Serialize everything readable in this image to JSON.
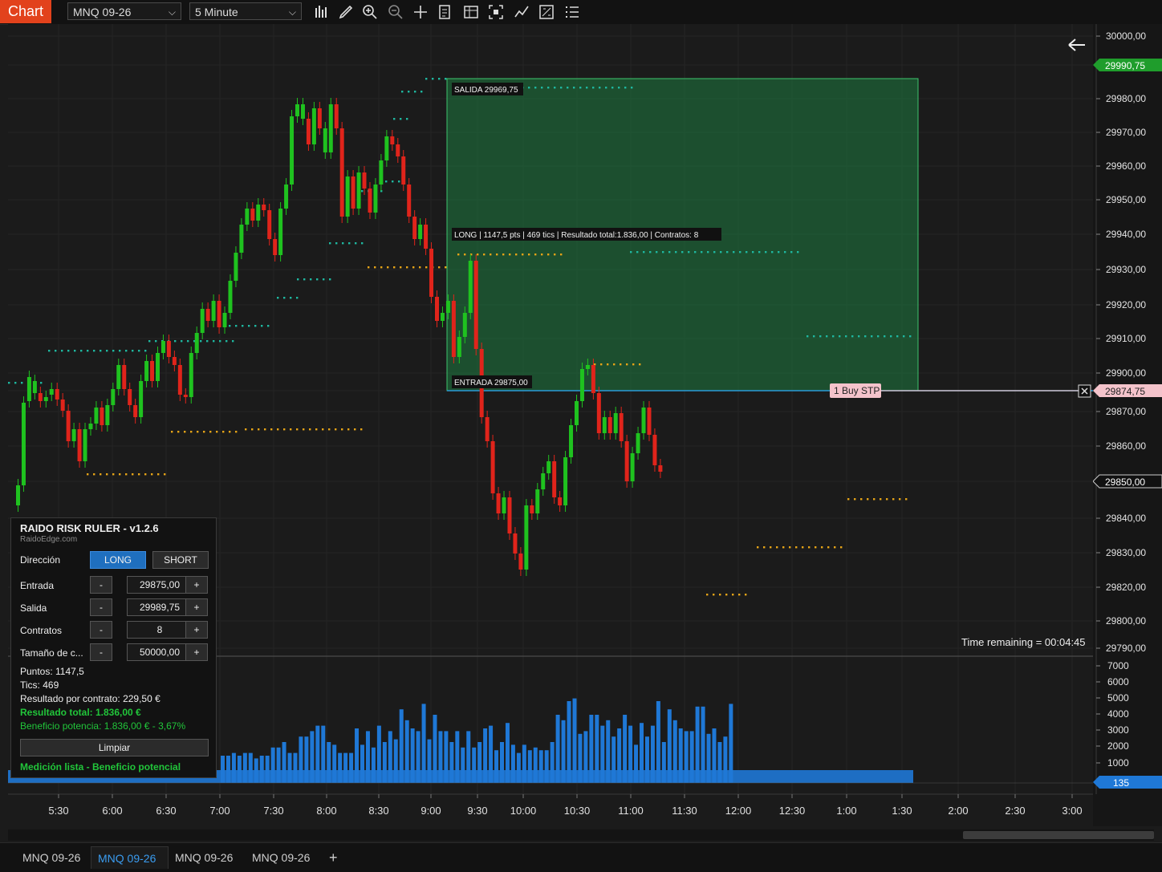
{
  "toolbar": {
    "chart_label": "Chart",
    "instrument": "MNQ 09-26",
    "interval": "5 Minute",
    "tools": [
      "bar-type-icon",
      "pencil-icon",
      "zoom-in-icon",
      "zoom-out-icon",
      "crosshair-icon",
      "template-icon",
      "data-box-icon",
      "properties-icon",
      "indicators-icon",
      "strategies-icon",
      "list-icon"
    ]
  },
  "chart": {
    "price_axis": [
      "30000,00",
      "29990,75",
      "29980,00",
      "29970,00",
      "29960,00",
      "29950,00",
      "29940,00",
      "29930,00",
      "29920,00",
      "29910,00",
      "29900,00",
      "29874,75",
      "29870,00",
      "29860,00",
      "29850,00",
      "29840,00",
      "29830,00",
      "29820,00",
      "29800,00",
      "29790,00"
    ],
    "current_price_marker": "29990,75",
    "order_price_marker": "29874,75",
    "last_price_marker": "29850,00",
    "volume_axis": [
      "7000",
      "6000",
      "5000",
      "4000",
      "3000",
      "2000",
      "1000"
    ],
    "volume_marker": "135",
    "time_axis": [
      "5:30",
      "6:00",
      "6:30",
      "7:00",
      "7:30",
      "8:00",
      "8:30",
      "9:00",
      "9:30",
      "10:00",
      "10:30",
      "11:00",
      "11:30",
      "12:00",
      "12:30",
      "1:00",
      "1:30",
      "2:00",
      "2:30",
      "3:00"
    ],
    "salida_label": "SALIDA  29969,75",
    "entrada_label": "ENTRADA  29875,00",
    "summary_label": "LONG  |  1147,5 pts  |  469 tics  |  Resultado total:1.836,00  |  Contratos: 8",
    "order_label": "1 Buy STP",
    "time_remaining": "Time remaining = 00:04:45",
    "colors": {
      "up": "#1fc21f",
      "down": "#e0241b",
      "volume": "#1f78d6",
      "zone": "#1e7a40",
      "entry_line": "#2a9bd8"
    }
  },
  "panel": {
    "title": "RAIDO RISK RULER - v1.2.6",
    "site": "RaidoEdge.com",
    "direction_label": "Dirección",
    "long": "LONG",
    "short": "SHORT",
    "rows": [
      {
        "label": "Entrada",
        "value": "29875,00"
      },
      {
        "label": "Salida",
        "value": "29989,75"
      },
      {
        "label": "Contratos",
        "value": "8"
      },
      {
        "label": "Tamaño de c...",
        "value": "50000,00"
      }
    ],
    "minus": "-",
    "plus": "+",
    "puntos": "Puntos: 1147,5",
    "tics": "Tics:  469",
    "resultado_contrato": "Resultado por contrato: 229,50 €",
    "resultado_total": "Resultado total: 1.836,00 €",
    "beneficio": "Beneficio potencia: 1.836,00 € - 3,67%",
    "clear": "Limpiar",
    "status": "Medición lista - Beneficio potencial"
  },
  "tabs": [
    "MNQ 09-26",
    "MNQ 09-26",
    "MNQ 09-26",
    "MNQ 09-26"
  ],
  "add_tab": "+"
}
